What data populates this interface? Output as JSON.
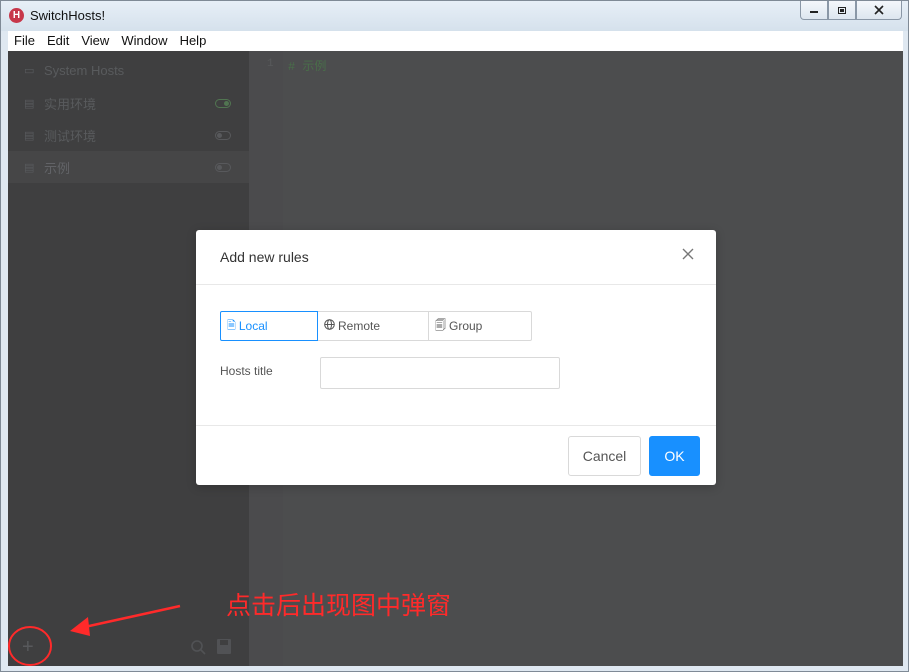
{
  "window": {
    "title": "SwitchHosts!",
    "app_icon_letter": "H",
    "controls": {
      "minimize": "▭",
      "restore": "⧉",
      "close": "✕"
    }
  },
  "menu": [
    "File",
    "Edit",
    "View",
    "Window",
    "Help"
  ],
  "sidebar": {
    "items": [
      {
        "label": "System Hosts",
        "icon": "monitor-icon",
        "toggle": null
      },
      {
        "label": "实用环境",
        "icon": "file-icon",
        "toggle": "on"
      },
      {
        "label": "测试环境",
        "icon": "file-icon",
        "toggle": "off"
      },
      {
        "label": "示例",
        "icon": "file-icon",
        "toggle": "off",
        "active": true
      }
    ],
    "bottom": {
      "add": "+",
      "search": "search-icon",
      "save": "save-icon"
    }
  },
  "editor": {
    "line_number": "1",
    "code": "# 示例",
    "code_color": "#1f5f1f"
  },
  "modal": {
    "title": "Add new rules",
    "close": "×",
    "types": [
      {
        "label": "Local",
        "icon": "file-icon",
        "active": true
      },
      {
        "label": "Remote",
        "icon": "globe-icon",
        "active": false
      },
      {
        "label": "Group",
        "icon": "files-icon",
        "active": false
      }
    ],
    "hosts_title_label": "Hosts title",
    "hosts_title_value": "",
    "cancel": "Cancel",
    "ok": "OK"
  },
  "annotation": {
    "text": "点击后出现图中弹窗",
    "color": "#ff2a2a"
  },
  "colors": {
    "accent": "#1890ff",
    "toggle_on": "#2e6b2e"
  }
}
